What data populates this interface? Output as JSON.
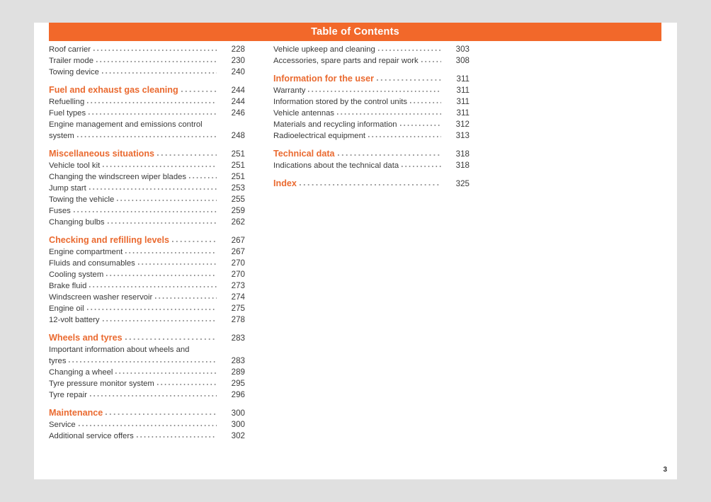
{
  "document": {
    "header_title": "Table of Contents",
    "folio": "3",
    "colors": {
      "accent": "#F2682A",
      "heading": "#EA6A30",
      "text": "#3a3a3a",
      "page_background": "#ffffff",
      "canvas_background": "#e0e0e0"
    }
  },
  "columns": [
    {
      "name": "left-column",
      "entries": [
        {
          "title": "Roof carrier",
          "page": "228",
          "type": "item"
        },
        {
          "title": "Trailer mode",
          "page": "230",
          "type": "item"
        },
        {
          "title": "Towing device",
          "page": "240",
          "type": "item"
        },
        {
          "title": "Fuel and exhaust gas cleaning",
          "page": "244",
          "type": "section"
        },
        {
          "title": "Refuelling",
          "page": "244",
          "type": "item"
        },
        {
          "title": "Fuel types",
          "page": "246",
          "type": "item"
        },
        {
          "title": "Engine management and emissions control",
          "page": "",
          "type": "continuation"
        },
        {
          "title": "system",
          "page": "248",
          "type": "item"
        },
        {
          "title": "Miscellaneous situations",
          "page": "251",
          "type": "section"
        },
        {
          "title": "Vehicle tool kit",
          "page": "251",
          "type": "item"
        },
        {
          "title": "Changing the windscreen wiper blades",
          "page": "251",
          "type": "item"
        },
        {
          "title": "Jump start",
          "page": "253",
          "type": "item"
        },
        {
          "title": "Towing the vehicle",
          "page": "255",
          "type": "item"
        },
        {
          "title": "Fuses",
          "page": "259",
          "type": "item"
        },
        {
          "title": "Changing bulbs",
          "page": "262",
          "type": "item"
        },
        {
          "title": "Checking and refilling levels",
          "page": "267",
          "type": "section"
        },
        {
          "title": "Engine compartment",
          "page": "267",
          "type": "item"
        },
        {
          "title": "Fluids and consumables",
          "page": "270",
          "type": "item"
        },
        {
          "title": "Cooling system",
          "page": "270",
          "type": "item"
        },
        {
          "title": "Brake fluid",
          "page": "273",
          "type": "item"
        },
        {
          "title": "Windscreen washer reservoir",
          "page": "274",
          "type": "item"
        },
        {
          "title": "Engine oil",
          "page": "275",
          "type": "item"
        },
        {
          "title": "12-volt battery",
          "page": "278",
          "type": "item"
        },
        {
          "title": "Wheels and tyres",
          "page": "283",
          "type": "section"
        },
        {
          "title": "Important information about wheels and",
          "page": "",
          "type": "continuation"
        },
        {
          "title": "tyres",
          "page": "283",
          "type": "item"
        },
        {
          "title": "Changing a wheel",
          "page": "289",
          "type": "item"
        },
        {
          "title": "Tyre pressure monitor system",
          "page": "295",
          "type": "item"
        },
        {
          "title": "Tyre repair",
          "page": "296",
          "type": "item"
        },
        {
          "title": "Maintenance",
          "page": "300",
          "type": "section"
        },
        {
          "title": "Service",
          "page": "300",
          "type": "item"
        },
        {
          "title": "Additional service offers",
          "page": "302",
          "type": "item"
        }
      ]
    },
    {
      "name": "right-column",
      "entries": [
        {
          "title": "Vehicle upkeep and cleaning",
          "page": "303",
          "type": "item"
        },
        {
          "title": "Accessories, spare parts and repair work",
          "page": "308",
          "type": "item"
        },
        {
          "title": "Information for the user",
          "page": "311",
          "type": "section"
        },
        {
          "title": "Warranty",
          "page": "311",
          "type": "item"
        },
        {
          "title": "Information stored by the control units",
          "page": "311",
          "type": "item"
        },
        {
          "title": "Vehicle antennas",
          "page": "311",
          "type": "item"
        },
        {
          "title": "Materials and recycling information",
          "page": "312",
          "type": "item"
        },
        {
          "title": "Radioelectrical equipment",
          "page": "313",
          "type": "item"
        },
        {
          "title": "Technical data",
          "page": "318",
          "type": "section"
        },
        {
          "title": "Indications about the technical data",
          "page": "318",
          "type": "item"
        },
        {
          "title": "Index",
          "page": "325",
          "type": "section"
        }
      ]
    }
  ]
}
